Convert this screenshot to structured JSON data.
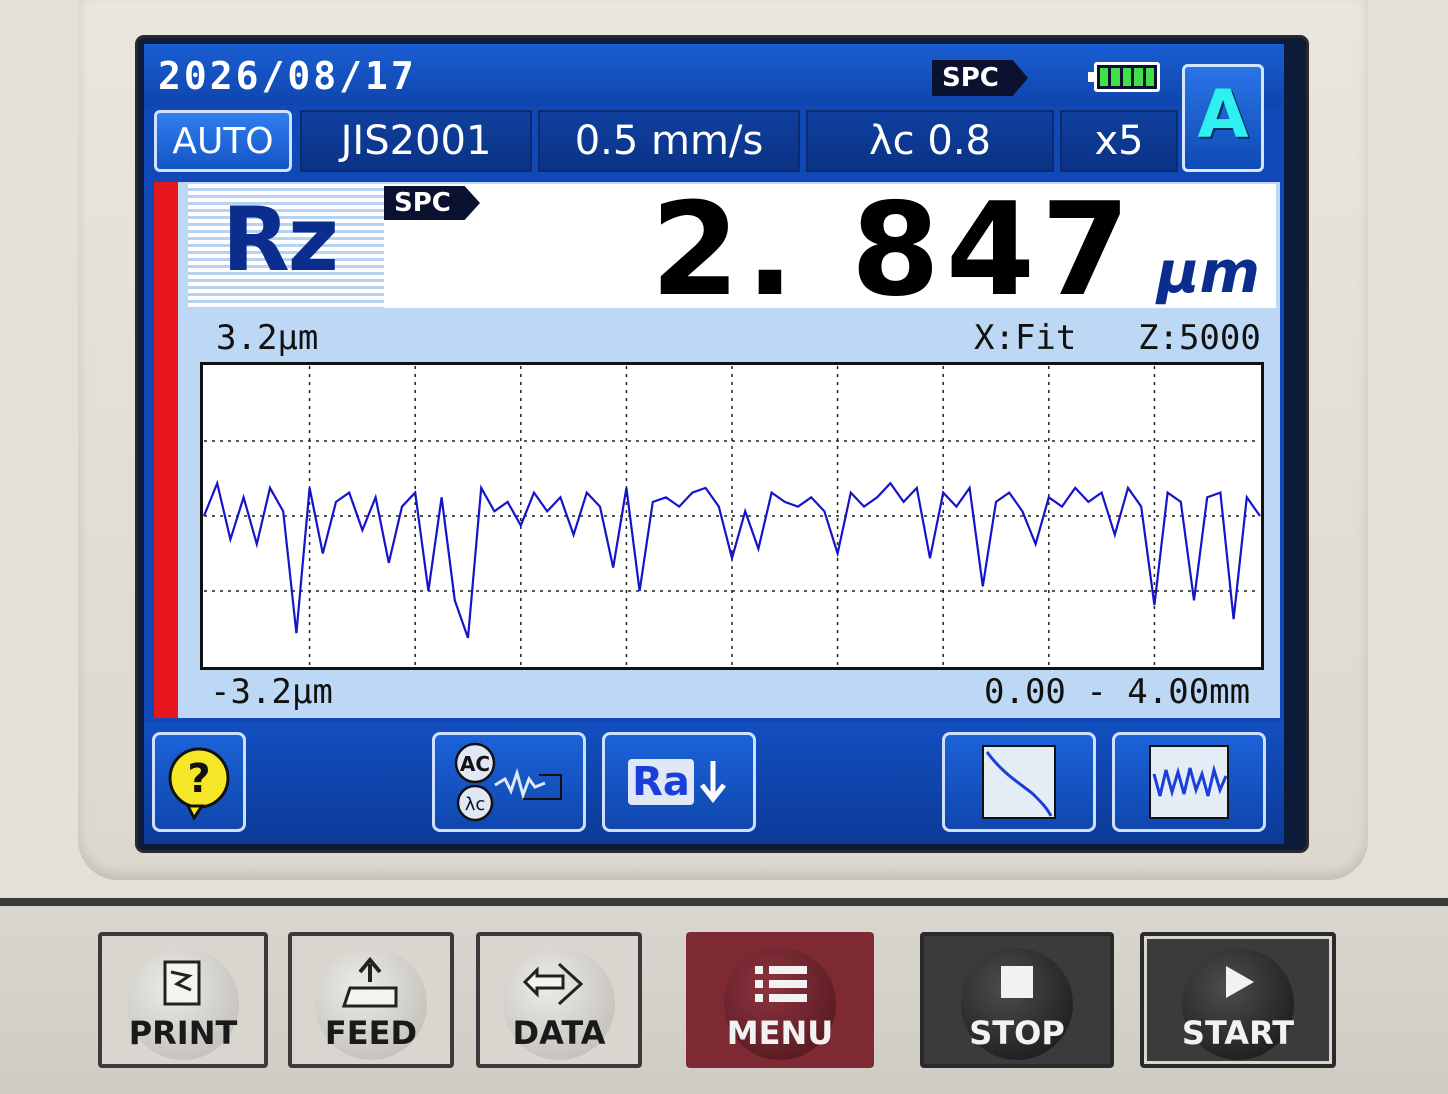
{
  "status": {
    "date": "2026/08/17",
    "spc_label": "SPC",
    "battery_cells": 5,
    "mode_label": "A"
  },
  "settings": {
    "auto_label": "AUTO",
    "standard": "JIS2001",
    "speed": "0.5 mm/s",
    "cutoff": "λc 0.8",
    "sampling": "x5"
  },
  "result": {
    "parameter": "Rz",
    "spc_label": "SPC",
    "value": "2. 847",
    "unit": "µm"
  },
  "graph": {
    "y_max_label": "3.2µm",
    "y_min_label": "-3.2µm",
    "x_scale_label": "X:Fit",
    "z_scale_label": "Z:5000",
    "x_range_label": "0.00 - 4.00mm"
  },
  "chart_data": {
    "type": "line",
    "title": "",
    "xlabel": "",
    "ylabel": "",
    "xlim": [
      0,
      4.0
    ],
    "ylim": [
      -3.2,
      3.2
    ],
    "grid": true,
    "series": [
      {
        "color": "#1414c8",
        "x": [
          0.0,
          0.05,
          0.1,
          0.15,
          0.2,
          0.25,
          0.3,
          0.35,
          0.4,
          0.45,
          0.5,
          0.55,
          0.6,
          0.65,
          0.7,
          0.75,
          0.8,
          0.85,
          0.9,
          0.95,
          1.0,
          1.05,
          1.1,
          1.15,
          1.2,
          1.25,
          1.3,
          1.35,
          1.4,
          1.45,
          1.5,
          1.55,
          1.6,
          1.65,
          1.7,
          1.75,
          1.8,
          1.85,
          1.9,
          1.95,
          2.0,
          2.05,
          2.1,
          2.15,
          2.2,
          2.25,
          2.3,
          2.35,
          2.4,
          2.45,
          2.5,
          2.55,
          2.6,
          2.65,
          2.7,
          2.75,
          2.8,
          2.85,
          2.9,
          2.95,
          3.0,
          3.05,
          3.1,
          3.15,
          3.2,
          3.25,
          3.3,
          3.35,
          3.4,
          3.45,
          3.5,
          3.55,
          3.6,
          3.65,
          3.7,
          3.75,
          3.8,
          3.85,
          3.9,
          3.95,
          4.0
        ],
        "y": [
          0.0,
          0.7,
          -0.5,
          0.4,
          -0.6,
          0.6,
          0.1,
          -2.5,
          0.6,
          -0.8,
          0.3,
          0.5,
          -0.3,
          0.4,
          -1.0,
          0.2,
          0.5,
          -1.6,
          0.4,
          -1.8,
          -2.6,
          0.6,
          0.1,
          0.3,
          -0.2,
          0.5,
          0.1,
          0.4,
          -0.4,
          0.5,
          0.2,
          -1.1,
          0.6,
          -1.6,
          0.3,
          0.4,
          0.2,
          0.5,
          0.6,
          0.2,
          -0.9,
          0.1,
          -0.7,
          0.5,
          0.3,
          0.2,
          0.4,
          0.1,
          -0.8,
          0.5,
          0.2,
          0.4,
          0.7,
          0.3,
          0.6,
          -0.9,
          0.5,
          0.2,
          0.6,
          -1.5,
          0.3,
          0.5,
          0.1,
          -0.6,
          0.4,
          0.2,
          0.6,
          0.3,
          0.5,
          -0.4,
          0.6,
          0.2,
          -1.9,
          0.5,
          0.3,
          -1.8,
          0.4,
          0.5,
          -2.2,
          0.4,
          0.0
        ]
      }
    ]
  },
  "softkeys": {
    "help_icon": "question-icon",
    "filter_icon": "ac-lambda-filter-icon",
    "param_label": "Ra",
    "bearing_icon": "bearing-curve-icon",
    "profile_icon": "profile-wave-icon"
  },
  "hardware": {
    "print_label": "PRINT",
    "feed_label": "FEED",
    "data_label": "DATA",
    "menu_label": "MENU",
    "stop_label": "STOP",
    "start_label": "START"
  },
  "colors": {
    "lcd_blue": "#1148b8",
    "trace_blue": "#1414c8",
    "alert_red": "#e8171e",
    "mode_cyan": "#2ef0f0",
    "battery_green": "#3fe04a"
  }
}
